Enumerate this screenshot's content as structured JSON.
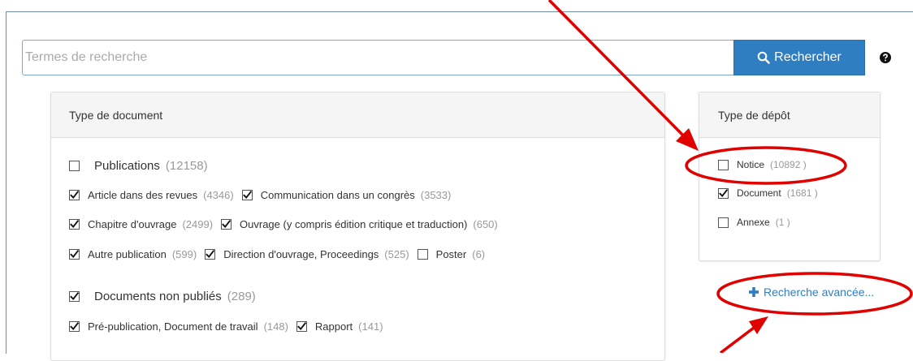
{
  "search": {
    "placeholder": "Termes de recherche",
    "button_label": "Rechercher",
    "help_icon": "question-circle-icon"
  },
  "document_type_panel": {
    "title": "Type de document",
    "groups": [
      {
        "label": "Publications",
        "count": "(12158)",
        "checked": false,
        "lines": [
          [
            {
              "label": "Article dans des revues",
              "count": "(4346)",
              "checked": true
            },
            {
              "label": "Communication dans un congrès",
              "count": "(3533)",
              "checked": true
            }
          ],
          [
            {
              "label": "Chapitre d'ouvrage",
              "count": "(2499)",
              "checked": true
            },
            {
              "label": "Ouvrage (y compris édition critique et traduction)",
              "count": "(650)",
              "checked": true
            }
          ],
          [
            {
              "label": "Autre publication",
              "count": "(599)",
              "checked": true
            },
            {
              "label": "Direction d'ouvrage, Proceedings",
              "count": "(525)",
              "checked": true
            },
            {
              "label": "Poster",
              "count": "(6)",
              "checked": false
            }
          ]
        ]
      },
      {
        "label": "Documents non publiés",
        "count": "(289)",
        "checked": true,
        "lines": [
          [
            {
              "label": "Pré-publication, Document de travail",
              "count": "(148)",
              "checked": true
            },
            {
              "label": "Rapport",
              "count": "(141)",
              "checked": true
            }
          ]
        ]
      }
    ]
  },
  "deposit_type_panel": {
    "title": "Type de dépôt",
    "items": [
      {
        "label": "Notice",
        "count": "(10892 )",
        "checked": false
      },
      {
        "label": "Document",
        "count": "(1681 )",
        "checked": true
      },
      {
        "label": "Annexe",
        "count": "(1 )",
        "checked": false
      }
    ]
  },
  "advanced_search": {
    "label": "Recherche avancée...",
    "icon": "plus-icon"
  },
  "colors": {
    "primary": "#2f7ec2",
    "annotation": "#e00000",
    "panel_header": "#f5f5f5"
  }
}
